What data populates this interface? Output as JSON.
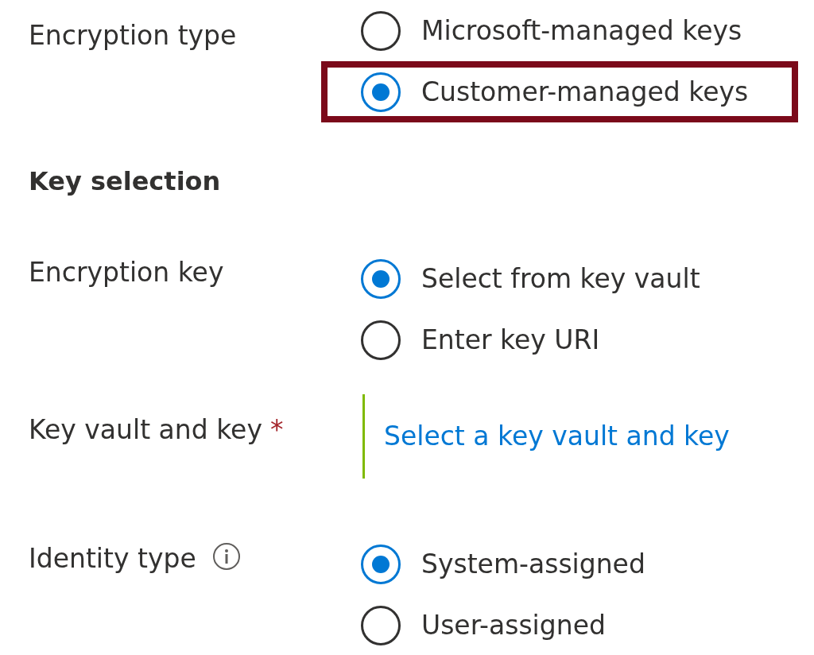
{
  "fields": [
    {
      "kind": "radio",
      "label": "Encryption type",
      "info": false,
      "options": [
        {
          "label": "Microsoft-managed keys",
          "selected": false,
          "highlighted": false
        },
        {
          "label": "Customer-managed keys",
          "selected": true,
          "highlighted": true
        }
      ]
    },
    {
      "kind": "heading",
      "label": "Key selection"
    },
    {
      "kind": "radio",
      "label": "Encryption key",
      "info": false,
      "options": [
        {
          "label": "Select from key vault",
          "selected": true,
          "highlighted": false
        },
        {
          "label": "Enter key URI",
          "selected": false,
          "highlighted": false
        }
      ]
    },
    {
      "kind": "link",
      "label": "Key vault and key",
      "required_mark": "*",
      "link": "Select a key vault and key"
    },
    {
      "kind": "radio",
      "label": "Identity type",
      "info": true,
      "options": [
        {
          "label": "System-assigned",
          "selected": true,
          "highlighted": false
        },
        {
          "label": "User-assigned",
          "selected": false,
          "highlighted": false
        }
      ]
    }
  ]
}
